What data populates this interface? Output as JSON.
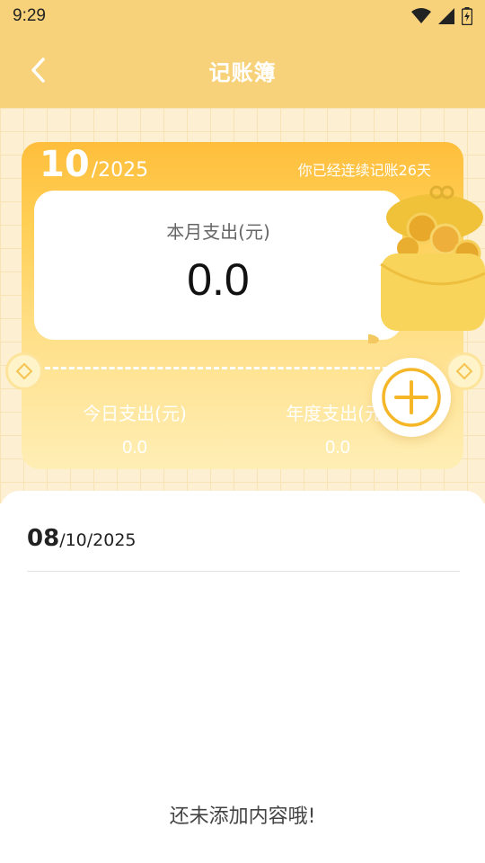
{
  "status_bar": {
    "time": "9:29"
  },
  "header": {
    "title": "记账簿"
  },
  "card": {
    "month": "10",
    "year": "/2025",
    "streak_text": "你已经连续记账26天",
    "month_label": "本月支出(元)",
    "month_value": "0.0",
    "today_label": "今日支出(元)",
    "today_value": "0.0",
    "year_label": "年度支出(元)",
    "year_value": "0.0"
  },
  "list": {
    "date_day": "08",
    "date_rest": "/10/2025",
    "empty_message": "还未添加内容哦!"
  },
  "colors": {
    "header_bg": "#f7d27a",
    "card_top": "#ffbe3c",
    "card_bottom": "#ffeeb5",
    "accent": "#f5b728"
  },
  "icons": {
    "back": "chevron-left-icon",
    "add": "plus-circle-icon",
    "wallet": "coin-wallet-icon"
  }
}
